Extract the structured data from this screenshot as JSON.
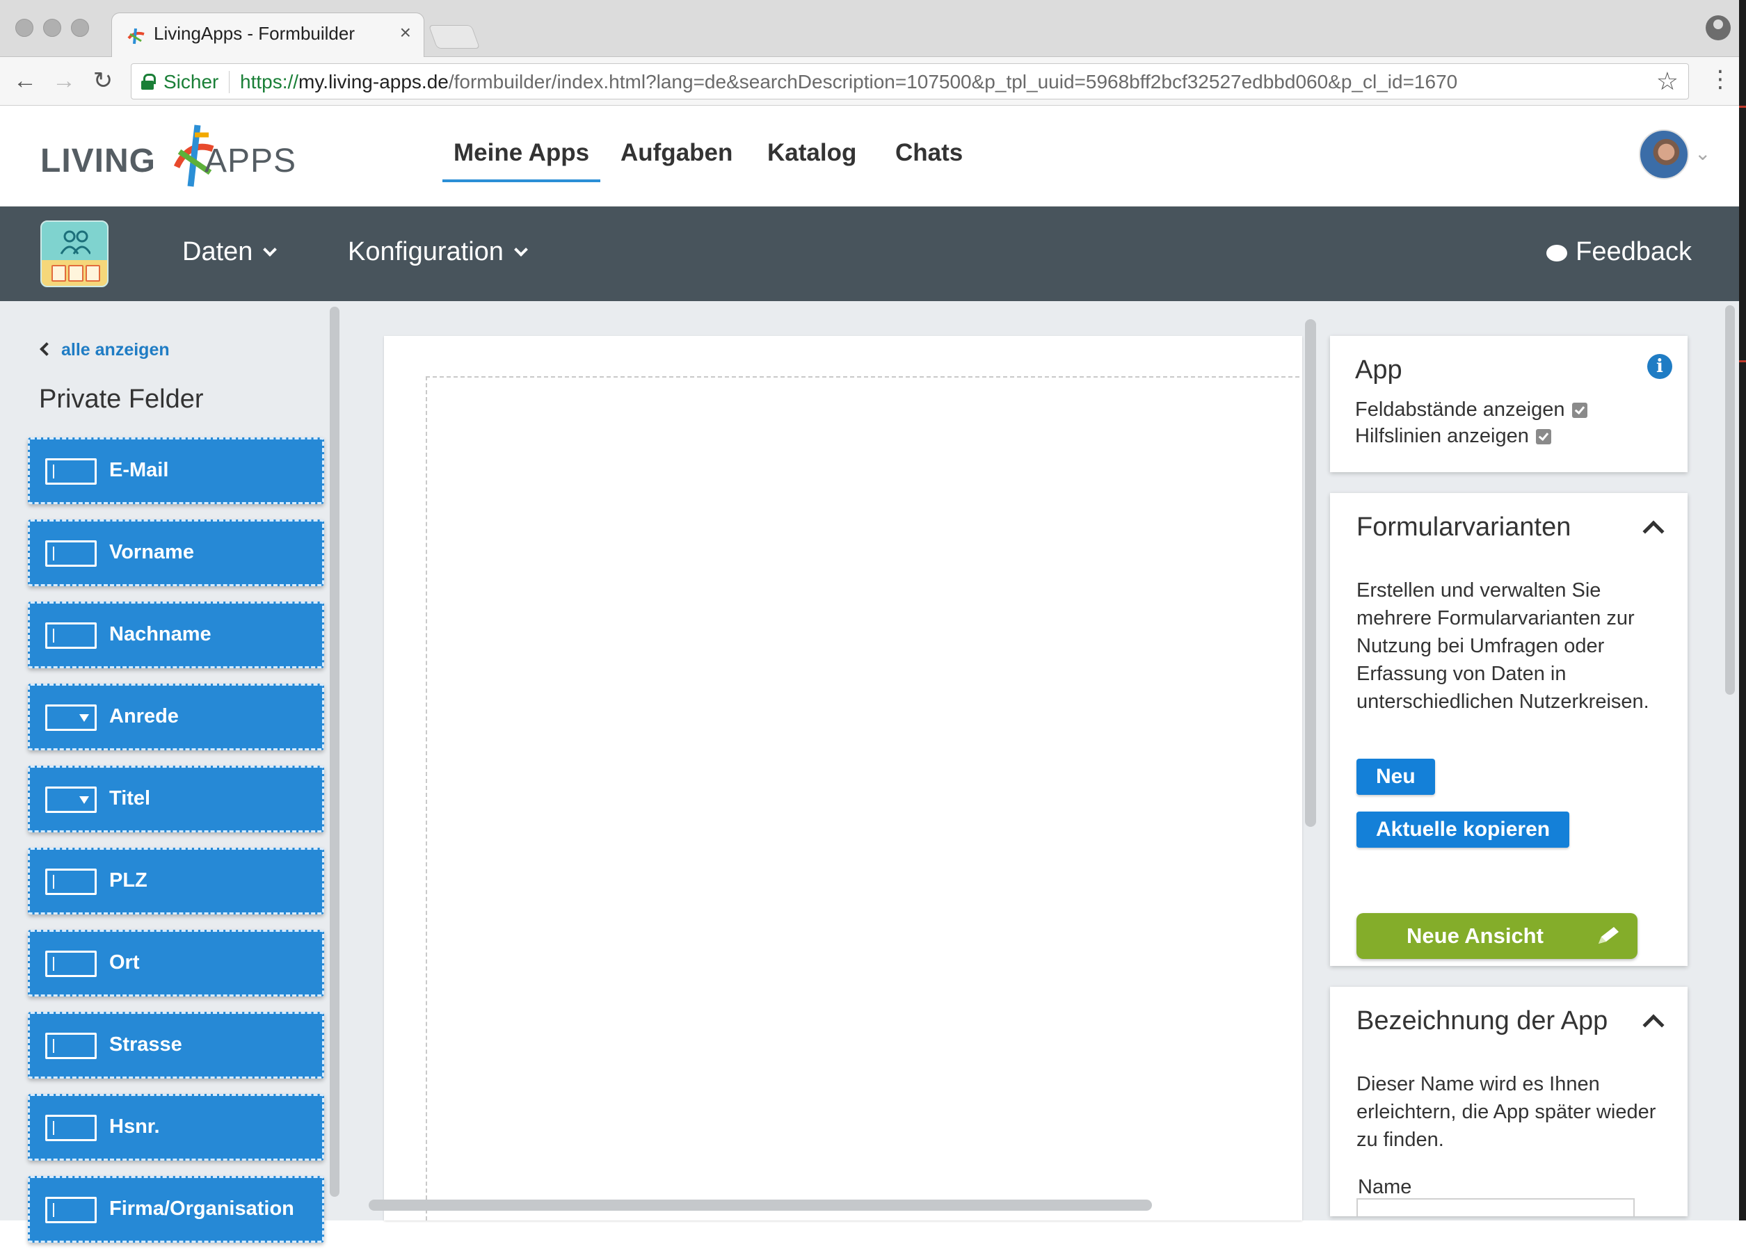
{
  "browser": {
    "tab_title": "LivingApps - Formbuilder",
    "tab_close": "×",
    "secure_label": "Sicher",
    "url_protocol": "https://",
    "url_host": "my.living-apps.de",
    "url_path": "/formbuilder/index.html?lang=de&searchDescription=107500&p_tpl_uuid=5968bff2bcf32527edbbd060&p_cl_id=1670",
    "back_glyph": "←",
    "forward_glyph": "→",
    "reload_glyph": "↻",
    "star_glyph": "☆",
    "menu_glyph": "⋮"
  },
  "header": {
    "logo_left": "LIVING",
    "logo_right": "APPS",
    "nav": [
      {
        "label": "Meine Apps",
        "active": true
      },
      {
        "label": "Aufgaben",
        "active": false
      },
      {
        "label": "Katalog",
        "active": false
      },
      {
        "label": "Chats",
        "active": false
      }
    ]
  },
  "toolbar": {
    "menus": [
      {
        "label": "Daten"
      },
      {
        "label": "Konfiguration"
      }
    ],
    "feedback_label": "Feedback"
  },
  "left_panel": {
    "back_label": "alle anzeigen",
    "title": "Private Felder",
    "fields": [
      {
        "label": "E-Mail",
        "kind": "text"
      },
      {
        "label": "Vorname",
        "kind": "text"
      },
      {
        "label": "Nachname",
        "kind": "text"
      },
      {
        "label": "Anrede",
        "kind": "select"
      },
      {
        "label": "Titel",
        "kind": "select"
      },
      {
        "label": "PLZ",
        "kind": "text"
      },
      {
        "label": "Ort",
        "kind": "text"
      },
      {
        "label": "Strasse",
        "kind": "text"
      },
      {
        "label": "Hsnr.",
        "kind": "text"
      },
      {
        "label": "Firma/Organisation",
        "kind": "text"
      }
    ]
  },
  "right_panel": {
    "app_card": {
      "title": "App",
      "info_glyph": "i",
      "show_spacing_label": "Feldabstände anzeigen",
      "show_spacing_checked": true,
      "show_guides_label": "Hilfslinien anzeigen",
      "show_guides_checked": true
    },
    "variants_card": {
      "title": "Formularvarianten",
      "description": "Erstellen und verwalten Sie mehrere Formularvarianten zur Nutzung bei Umfragen oder Erfassung von Daten in unterschiedlichen Nutzerkreisen.",
      "new_button": "Neu",
      "copy_button": "Aktuelle kopieren",
      "new_view_button": "Neue Ansicht"
    },
    "name_card": {
      "title": "Bezeichnung der App",
      "description": "Dieser Name wird es Ihnen erleichtern, die App später wieder zu finden.",
      "name_label": "Name",
      "name_value": ""
    }
  },
  "colors": {
    "toolbar_bg": "#48545c",
    "field_blue": "#2689d6",
    "button_blue": "#1480d8",
    "button_green": "#84ad2a",
    "link_blue": "#1f7cc4",
    "secure_green": "#1a7f37"
  }
}
